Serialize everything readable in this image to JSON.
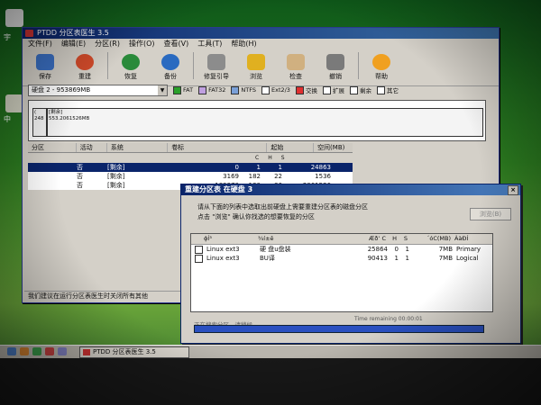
{
  "main_window": {
    "title": "PTDD 分区表医生 3.5",
    "menu": [
      "文件(F)",
      "编辑(E)",
      "分区(R)",
      "操作(O)",
      "查看(V)",
      "工具(T)",
      "帮助(H)"
    ],
    "toolbar": [
      {
        "label": "保存",
        "icon": "save-icon",
        "color": "#3a6fc2"
      },
      {
        "label": "重建",
        "icon": "rebuild-icon",
        "color": "#d04a2a"
      },
      {
        "label": "恢复",
        "icon": "restore-icon",
        "color": "#2a8a3a"
      },
      {
        "label": "备份",
        "icon": "backup-icon",
        "color": "#2a6ac0"
      },
      {
        "label": "修复引导",
        "icon": "repair-boot-icon",
        "color": "#8c8c8c"
      },
      {
        "label": "浏览",
        "icon": "browse-icon",
        "color": "#e0b020"
      },
      {
        "label": "检查",
        "icon": "check-icon",
        "color": "#d0b080"
      },
      {
        "label": "撤销",
        "icon": "undo-icon",
        "color": "#7a7a7a"
      },
      {
        "label": "帮助",
        "icon": "help-icon",
        "color": "#f0a020"
      }
    ],
    "disk_select": "硬盘 2 - 953869MB",
    "legend": [
      {
        "label": "FAT",
        "color": "#2aa02a"
      },
      {
        "label": "FAT32",
        "color": "#c0a0e0"
      },
      {
        "label": "NTFS",
        "color": "#7aa0d8"
      },
      {
        "label": "Ext2/3",
        "color": "#ffffff"
      },
      {
        "label": "交换",
        "color": "#e03030"
      },
      {
        "label": "扩展",
        "color": "#ffffff"
      },
      {
        "label": "剩余",
        "color": "#ffffff"
      },
      {
        "label": "其它",
        "color": "#ffffff"
      }
    ],
    "map_parts": [
      {
        "text": "(\n248"
      },
      {
        "text": "[剩余]\n553.2061526MB"
      }
    ],
    "table_headers": [
      "分区",
      "活动",
      "系统",
      "卷标",
      "起始",
      "空间(MB)"
    ],
    "chs_headers": [
      "C",
      "H",
      "S"
    ],
    "rows": [
      {
        "active": "否",
        "system": "[剩余]",
        "c": "0",
        "h": "1",
        "s": "1",
        "size": "24863",
        "selected": true
      },
      {
        "active": "否",
        "system": "[剩余]",
        "c": "3169",
        "h": "182",
        "s": "22",
        "size": "1536",
        "selected": false
      },
      {
        "active": "否",
        "system": "[剩余]",
        "c": "189370",
        "h": "130",
        "s": "36",
        "size": "2061526",
        "selected": false
      }
    ],
    "status": "我们建议在运行分区表医生时关闭所有其他"
  },
  "dialog": {
    "title": "重建分区表 在硬盘 3",
    "close": "×",
    "line1": "请从下面的列表中选取出前硬盘上需要重建分区表的磁盘分区",
    "line2": "点击 \"浏览\" 确认你找选的想要恢复的分区",
    "browse": "浏览(B)",
    "list_headers": [
      "ϕÍ³",
      "¾í±ê",
      "Æðʼ C",
      "H",
      "S",
      "´óС(MB)",
      "ÀàÐÍ"
    ],
    "list_rows": [
      {
        "system": "Linux ext3",
        "label": "硬  盘u盘装",
        "c": "25864",
        "h": "0",
        "s": "1",
        "size": "7MB",
        "type": "Primary"
      },
      {
        "system": "Linux ext3",
        "label": "BU译",
        "c": "90413",
        "h": "1",
        "s": "1",
        "size": "7MB",
        "type": "Logical"
      }
    ],
    "status": "正在搜索分区，请稍候",
    "time": "Time remaining 00:00:01"
  },
  "taskbar": {
    "item": "PTDD 分区表医生 3.5"
  },
  "desktop": {
    "icon1_label": "宇",
    "icon2_label": "中"
  }
}
